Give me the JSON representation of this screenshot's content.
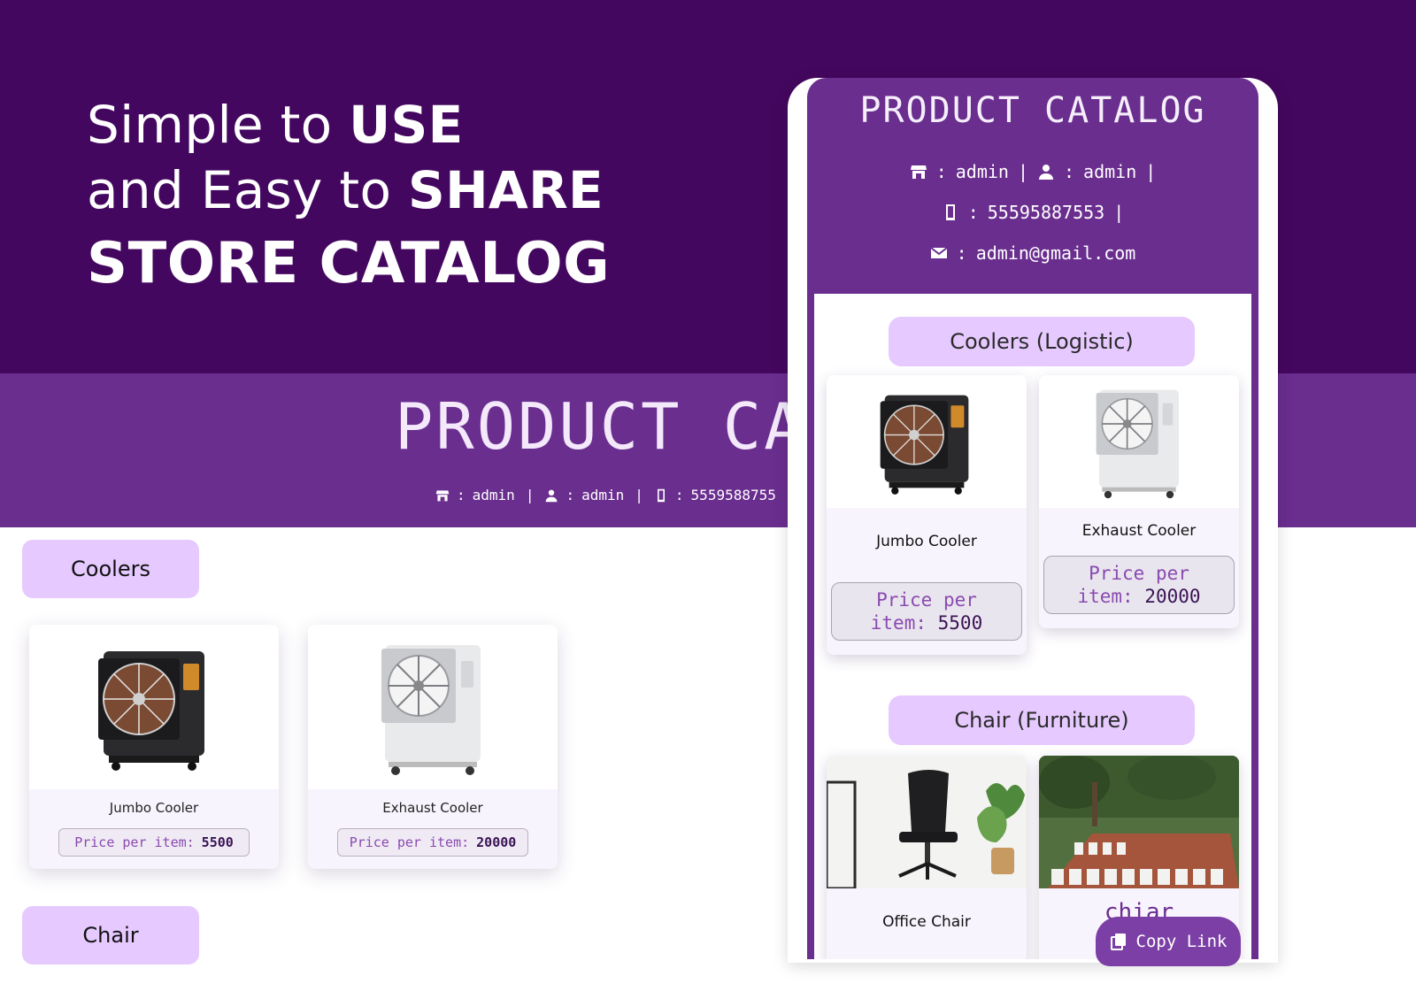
{
  "hero": {
    "line1_prefix": "Simple to ",
    "line1_strong": "USE",
    "line2_prefix": "and Easy to ",
    "line2_strong": "SHARE",
    "line3": "STORE CATALOG"
  },
  "background_catalog": {
    "title": "PRODUCT  CA",
    "info": {
      "store": "admin",
      "user": "admin",
      "phone": "5559588755"
    },
    "categories": [
      {
        "label": "Coolers",
        "items": [
          {
            "name": "Jumbo Cooler",
            "price_label": "Price per item:",
            "price": "5500"
          },
          {
            "name": "Exhaust Cooler",
            "price_label": "Price per item:",
            "price": "20000"
          }
        ]
      },
      {
        "label": "Chair"
      }
    ]
  },
  "phone_catalog": {
    "title": "PRODUCT CATALOG",
    "info": {
      "store": "admin",
      "user": "admin",
      "phone": "55595887553",
      "email": "admin@gmail.com"
    },
    "categories": [
      {
        "label": "Coolers (Logistic)",
        "items": [
          {
            "name": "Jumbo Cooler",
            "price_line1": "Price per",
            "price_label2": "item:",
            "price": "5500"
          },
          {
            "name": "Exhaust Cooler",
            "price_line1": "Price per",
            "price_label2": "item:",
            "price": "20000"
          }
        ]
      },
      {
        "label": "Chair (Furniture)",
        "items": [
          {
            "name": "Office Chair"
          },
          {
            "name": "chiar"
          }
        ]
      }
    ],
    "copy_link_label": "Copy Link"
  },
  "colors": {
    "hero_bg": "#44075f",
    "header_purple": "#6a2e8f",
    "pill_lavender": "#e6c9ff",
    "price_accent": "#8a4ab0"
  }
}
